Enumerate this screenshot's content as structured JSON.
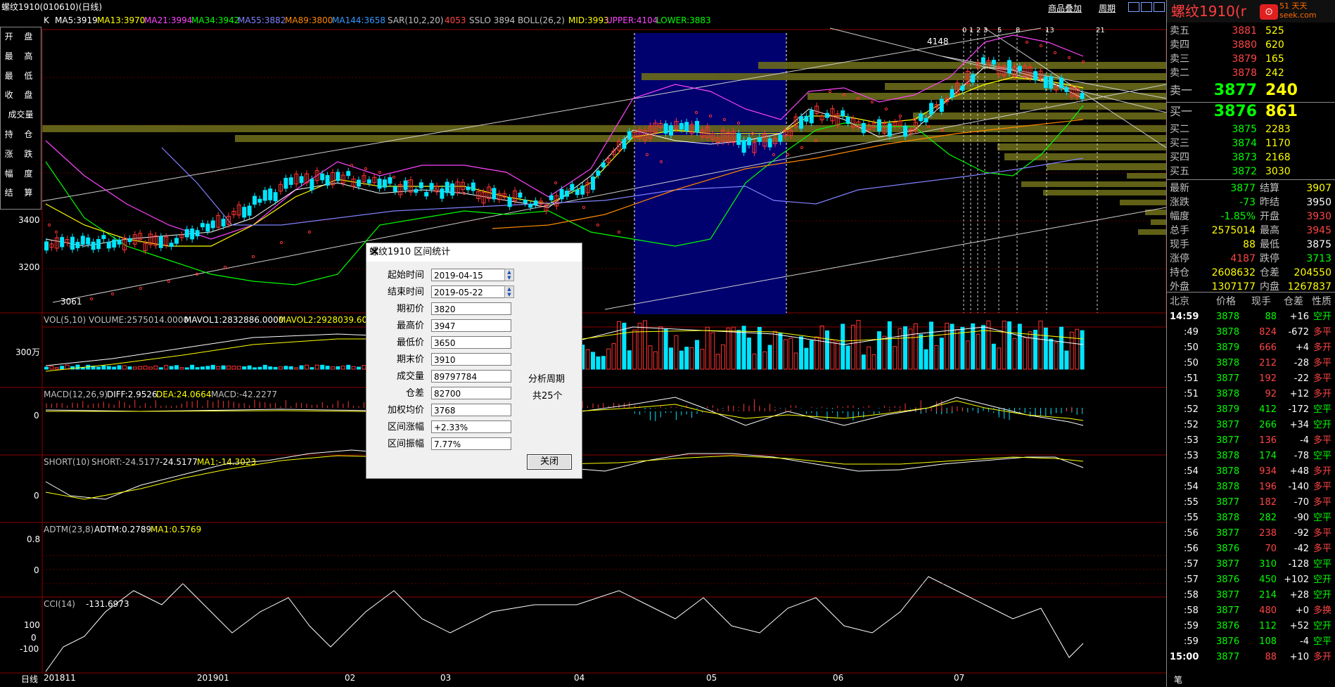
{
  "window_title": "螺纹1910(010610)(日线)",
  "top_links": {
    "add_product": "商品叠加",
    "period": "周期"
  },
  "main_indicators": {
    "k": "K",
    "ma5": "MA5:3919",
    "ma13": "MA13:3970",
    "ma21": "MA21:3994",
    "ma34": "MA34:3942",
    "ma55": "MA55:3882",
    "ma89": "MA89:3800",
    "ma144": "MA144:3658",
    "sar_label": "SAR(10,2,20)",
    "sar_value": "4053",
    "sslo": "SSLO 3894",
    "boll": "BOLL(26,2)",
    "mid": "MID:3993",
    "upper": "UPPER:4104",
    "lower": "LOWER:3883"
  },
  "left_panel": [
    "开 盘",
    "最 高",
    "最 低",
    "收 盘",
    "成交量",
    "持 仓",
    "涨 跌",
    "幅 度",
    "结 算"
  ],
  "price_axis": {
    "p3400": "3400",
    "p3200": "3200"
  },
  "annotations": {
    "high": "4148",
    "low": "3061",
    "counts": [
      "0",
      "1",
      "2",
      "3",
      "5",
      "8",
      "13",
      "21"
    ]
  },
  "volume_panel": {
    "label": "VOL(5,10)",
    "volume": "VOLUME:2575014.0000",
    "mavol1": "MAVOL1:2832886.0000",
    "mavol2": "MAVOL2:2928039.600",
    "axis": "300万"
  },
  "macd_panel": {
    "label": "MACD(12,26,9)",
    "diff": "DIFF:2.9526",
    "dea": "DEA:24.0664",
    "macd": "MACD:-42.2277",
    "axis0": "0"
  },
  "short_panel": {
    "label": "SHORT(10)",
    "short": "SHORT:-24.5177",
    "short2": "-24.5177",
    "ma1": "MA1:-14.3023",
    "axis0": "0"
  },
  "adtm_panel": {
    "label": "ADTM(23,8)",
    "adtm": "ADTM:0.2789",
    "ma1": "MA1:0.5769",
    "axis08": "0.8",
    "axis0": "0"
  },
  "cci_panel": {
    "label": "CCI(14)",
    "value": "-131.6973",
    "a100": "100",
    "a0": "0",
    "am100": "-100"
  },
  "date_axis": {
    "period": "日线",
    "d1": "201811",
    "d2": "201901",
    "d3": "02",
    "d4": "03",
    "d5": "04",
    "d6": "05",
    "d7": "06",
    "d8": "07"
  },
  "dialog": {
    "title": "螺纹1910 区间统计",
    "fields": [
      {
        "label": "起始时间",
        "value": "2019-04-15"
      },
      {
        "label": "结束时间",
        "value": "2019-05-22"
      },
      {
        "label": "期初价",
        "value": "3820"
      },
      {
        "label": "最高价",
        "value": "3947"
      },
      {
        "label": "最低价",
        "value": "3650"
      },
      {
        "label": "期末价",
        "value": "3910"
      },
      {
        "label": "成交量",
        "value": "89797784"
      },
      {
        "label": "仓差",
        "value": "82700"
      },
      {
        "label": "加权均价",
        "value": "3768"
      },
      {
        "label": "区间涨幅",
        "value": "+2.33%"
      },
      {
        "label": "区间振幅",
        "value": "7.77%"
      }
    ],
    "period_label": "分析周期",
    "period_value": "共25个",
    "close_label": "关闭"
  },
  "right_panel": {
    "title": "螺纹1910(r",
    "logo": "51 天天\nseek.com",
    "asks": [
      {
        "label": "卖五",
        "price": "3881",
        "vol": "525"
      },
      {
        "label": "卖四",
        "price": "3880",
        "vol": "620"
      },
      {
        "label": "卖三",
        "price": "3879",
        "vol": "165"
      },
      {
        "label": "卖二",
        "price": "3878",
        "vol": "242"
      },
      {
        "label": "卖一",
        "price": "3877",
        "vol": "240"
      }
    ],
    "bids": [
      {
        "label": "买一",
        "price": "3876",
        "vol": "861"
      },
      {
        "label": "买二",
        "price": "3875",
        "vol": "2283"
      },
      {
        "label": "买三",
        "price": "3874",
        "vol": "1170"
      },
      {
        "label": "买四",
        "price": "3873",
        "vol": "2168"
      },
      {
        "label": "买五",
        "price": "3872",
        "vol": "3030"
      }
    ],
    "stats": [
      {
        "l1": "最新",
        "v1": "3877",
        "l2": "结算",
        "v2": "3907"
      },
      {
        "l1": "涨跌",
        "v1": "-73",
        "l2": "昨结",
        "v2": "3950"
      },
      {
        "l1": "幅度",
        "v1": "-1.85%",
        "l2": "开盘",
        "v2": "3930"
      },
      {
        "l1": "总手",
        "v1": "2575014",
        "l2": "最高",
        "v2": "3945"
      },
      {
        "l1": "现手",
        "v1": "88",
        "l2": "最低",
        "v2": "3875"
      },
      {
        "l1": "涨停",
        "v1": "4187",
        "l2": "跌停",
        "v2": "3713"
      },
      {
        "l1": "持仓",
        "v1": "2608632",
        "l2": "仓差",
        "v2": "204550"
      },
      {
        "l1": "外盘",
        "v1": "1307177",
        "l2": "内盘",
        "v2": "1267837"
      }
    ],
    "tick_header": [
      "北京",
      "价格",
      "现手",
      "仓差",
      "性质"
    ],
    "ticks": [
      {
        "t": "14:59",
        "p": "3878",
        "v": "88",
        "d": "+16",
        "n": "空开"
      },
      {
        "t": ":49",
        "p": "3878",
        "v": "824",
        "d": "-672",
        "n": "多平"
      },
      {
        "t": ":50",
        "p": "3879",
        "v": "666",
        "d": "+4",
        "n": "多开"
      },
      {
        "t": ":50",
        "p": "3878",
        "v": "212",
        "d": "-28",
        "n": "多平"
      },
      {
        "t": ":51",
        "p": "3877",
        "v": "192",
        "d": "-22",
        "n": "多平"
      },
      {
        "t": ":51",
        "p": "3878",
        "v": "92",
        "d": "+12",
        "n": "多开"
      },
      {
        "t": ":52",
        "p": "3879",
        "v": "412",
        "d": "-172",
        "n": "空平"
      },
      {
        "t": ":52",
        "p": "3877",
        "v": "266",
        "d": "+34",
        "n": "空开"
      },
      {
        "t": ":53",
        "p": "3877",
        "v": "136",
        "d": "-4",
        "n": "多平"
      },
      {
        "t": ":53",
        "p": "3878",
        "v": "174",
        "d": "-78",
        "n": "空平"
      },
      {
        "t": ":54",
        "p": "3878",
        "v": "934",
        "d": "+48",
        "n": "多开"
      },
      {
        "t": ":54",
        "p": "3878",
        "v": "196",
        "d": "-140",
        "n": "多平"
      },
      {
        "t": ":55",
        "p": "3877",
        "v": "182",
        "d": "-70",
        "n": "多平"
      },
      {
        "t": ":55",
        "p": "3878",
        "v": "282",
        "d": "-90",
        "n": "空平"
      },
      {
        "t": ":56",
        "p": "3877",
        "v": "238",
        "d": "-92",
        "n": "多平"
      },
      {
        "t": ":56",
        "p": "3876",
        "v": "70",
        "d": "-42",
        "n": "多平"
      },
      {
        "t": ":57",
        "p": "3877",
        "v": "310",
        "d": "-128",
        "n": "空平"
      },
      {
        "t": ":57",
        "p": "3876",
        "v": "450",
        "d": "+102",
        "n": "空开"
      },
      {
        "t": ":58",
        "p": "3877",
        "v": "214",
        "d": "+28",
        "n": "空开"
      },
      {
        "t": ":58",
        "p": "3877",
        "v": "480",
        "d": "+0",
        "n": "多换"
      },
      {
        "t": ":59",
        "p": "3876",
        "v": "112",
        "d": "+52",
        "n": "空开"
      },
      {
        "t": ":59",
        "p": "3876",
        "v": "108",
        "d": "-4",
        "n": "空平"
      },
      {
        "t": "15:00",
        "p": "3877",
        "v": "88",
        "d": "+10",
        "n": "多开"
      }
    ],
    "bottom_tab": "笔"
  }
}
